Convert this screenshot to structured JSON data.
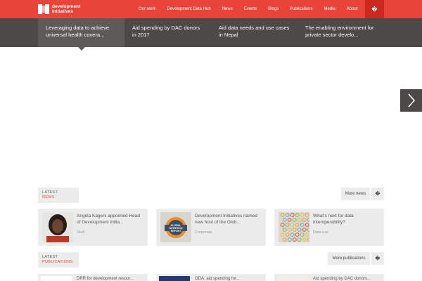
{
  "brand": {
    "line1": "development",
    "line2": "initiatives"
  },
  "nav": [
    "Our work",
    "Development Data Hub",
    "News",
    "Events",
    "Blogs",
    "Publications",
    "Media",
    "About"
  ],
  "search_glyph": "�",
  "stories": [
    "Leveraging data to achieve universal health covera...",
    "Aid spending by DAC donors in 2017",
    "Aid data needs and use cases in Nepal",
    "The enabling environment for private sector develo..."
  ],
  "slider_arrow": "chevron-right-icon",
  "news": {
    "label_top": "LATEST",
    "label_bottom": "NEWS",
    "more_label": "More news",
    "more_icon": "�",
    "items": [
      {
        "title": "Angela Kageni appointed Head of Development Initia...",
        "category": "Staff"
      },
      {
        "title": "Development Initiatives named new host of the Glob...",
        "category": "Corporate"
      },
      {
        "title": "What’s next for data interoperability?",
        "category": "Data use"
      }
    ]
  },
  "publications": {
    "label_top": "LATEST",
    "label_bottom": "PUBLICATIONS",
    "more_label": "More publications",
    "more_icon": "�",
    "items": [
      {
        "title": "DRR for development resour..."
      },
      {
        "title": "ODA: aid spending for..."
      },
      {
        "title": "Aid spending by DAC donors..."
      }
    ]
  },
  "badge_text": {
    "line1": "GLOBAL",
    "line2": "NUTRITION",
    "line3": "REPORT"
  },
  "colors": {
    "brand_red": "#e84439",
    "dark": "#4c4948",
    "panel": "#ececec"
  }
}
